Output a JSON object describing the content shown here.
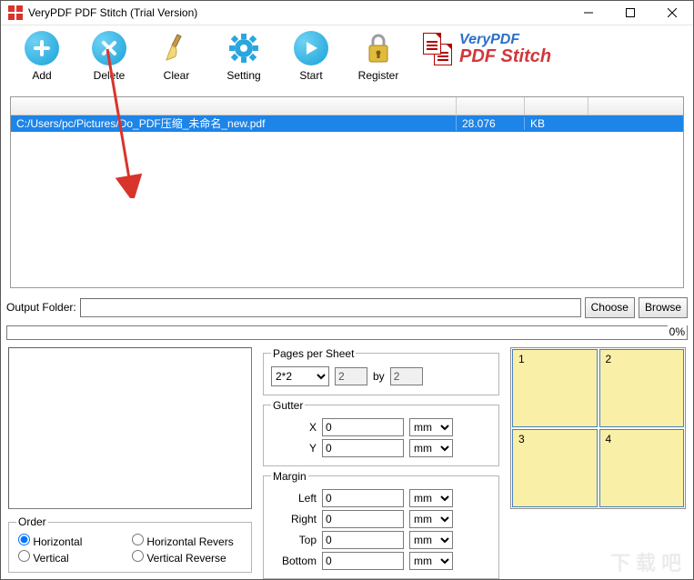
{
  "window": {
    "title": "VeryPDF PDF Stitch (Trial Version)"
  },
  "toolbar": {
    "add": "Add",
    "delete": "Delete",
    "clear": "Clear",
    "setting": "Setting",
    "start": "Start",
    "register": "Register"
  },
  "logo": {
    "line1": "VeryPDF",
    "line2": "PDF Stitch"
  },
  "files": {
    "headers": {
      "path": "",
      "size": "",
      "unit": ""
    },
    "rows": [
      {
        "path": "C:/Users/pc/Pictures/Do_PDF压缩_未命名_new.pdf",
        "size": "28.076",
        "unit": "KB"
      }
    ]
  },
  "output": {
    "label": "Output Folder:",
    "value": "",
    "choose": "Choose",
    "browse": "Browse"
  },
  "progress": {
    "percent": "0%"
  },
  "pagesPerSheet": {
    "legend": "Pages per Sheet",
    "layout": "2*2",
    "cols": "2",
    "rows": "2",
    "by": "by"
  },
  "gutter": {
    "legend": "Gutter",
    "xLabel": "X",
    "yLabel": "Y",
    "x": "0",
    "y": "0",
    "unit": "mm"
  },
  "margin": {
    "legend": "Margin",
    "leftLabel": "Left",
    "rightLabel": "Right",
    "topLabel": "Top",
    "bottomLabel": "Bottom",
    "left": "0",
    "right": "0",
    "top": "0",
    "bottom": "0",
    "unit": "mm"
  },
  "order": {
    "legend": "Order",
    "opts": {
      "h": "Horizontal",
      "hr": "Horizontal Revers",
      "v": "Vertical",
      "vr": "Vertical Reverse"
    },
    "selected": "h"
  },
  "thumbs": [
    "1",
    "2",
    "3",
    "4"
  ],
  "watermark": "下载吧"
}
